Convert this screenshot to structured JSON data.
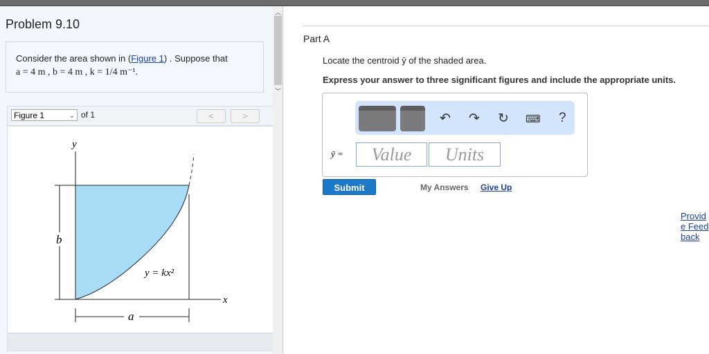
{
  "problem": {
    "title": "Problem 9.10",
    "text_prefix": "Consider the area shown in (",
    "figure_link": "Figure 1",
    "text_suffix": ") . Suppose that",
    "given": "a = 4  m , b = 4  m , k = 1/4  m⁻¹."
  },
  "figure": {
    "select_value": "Figure 1",
    "of_label": "of 1",
    "prev": "<",
    "next": ">",
    "labels": {
      "y": "y",
      "x": "x",
      "a": "a",
      "b": "b",
      "curve": "y = kx²"
    },
    "fill_color": "#a8dcf7"
  },
  "part": {
    "label": "Part A",
    "question": "Locate the centroid ȳ of the shaded area.",
    "instruction": "Express your answer to three significant figures and include the appropriate units."
  },
  "answer": {
    "var_label": "ȳ =",
    "value_placeholder": "Value",
    "units_placeholder": "Units",
    "toolbar": [
      "templates-icon",
      "units-icon",
      "undo-icon",
      "redo-icon",
      "reset-icon",
      "keyboard-icon",
      "help-icon"
    ],
    "help": "?"
  },
  "actions": {
    "submit": "Submit",
    "my_answers": "My Answers",
    "give_up": "Give Up",
    "provide": "Provide Feedback"
  }
}
